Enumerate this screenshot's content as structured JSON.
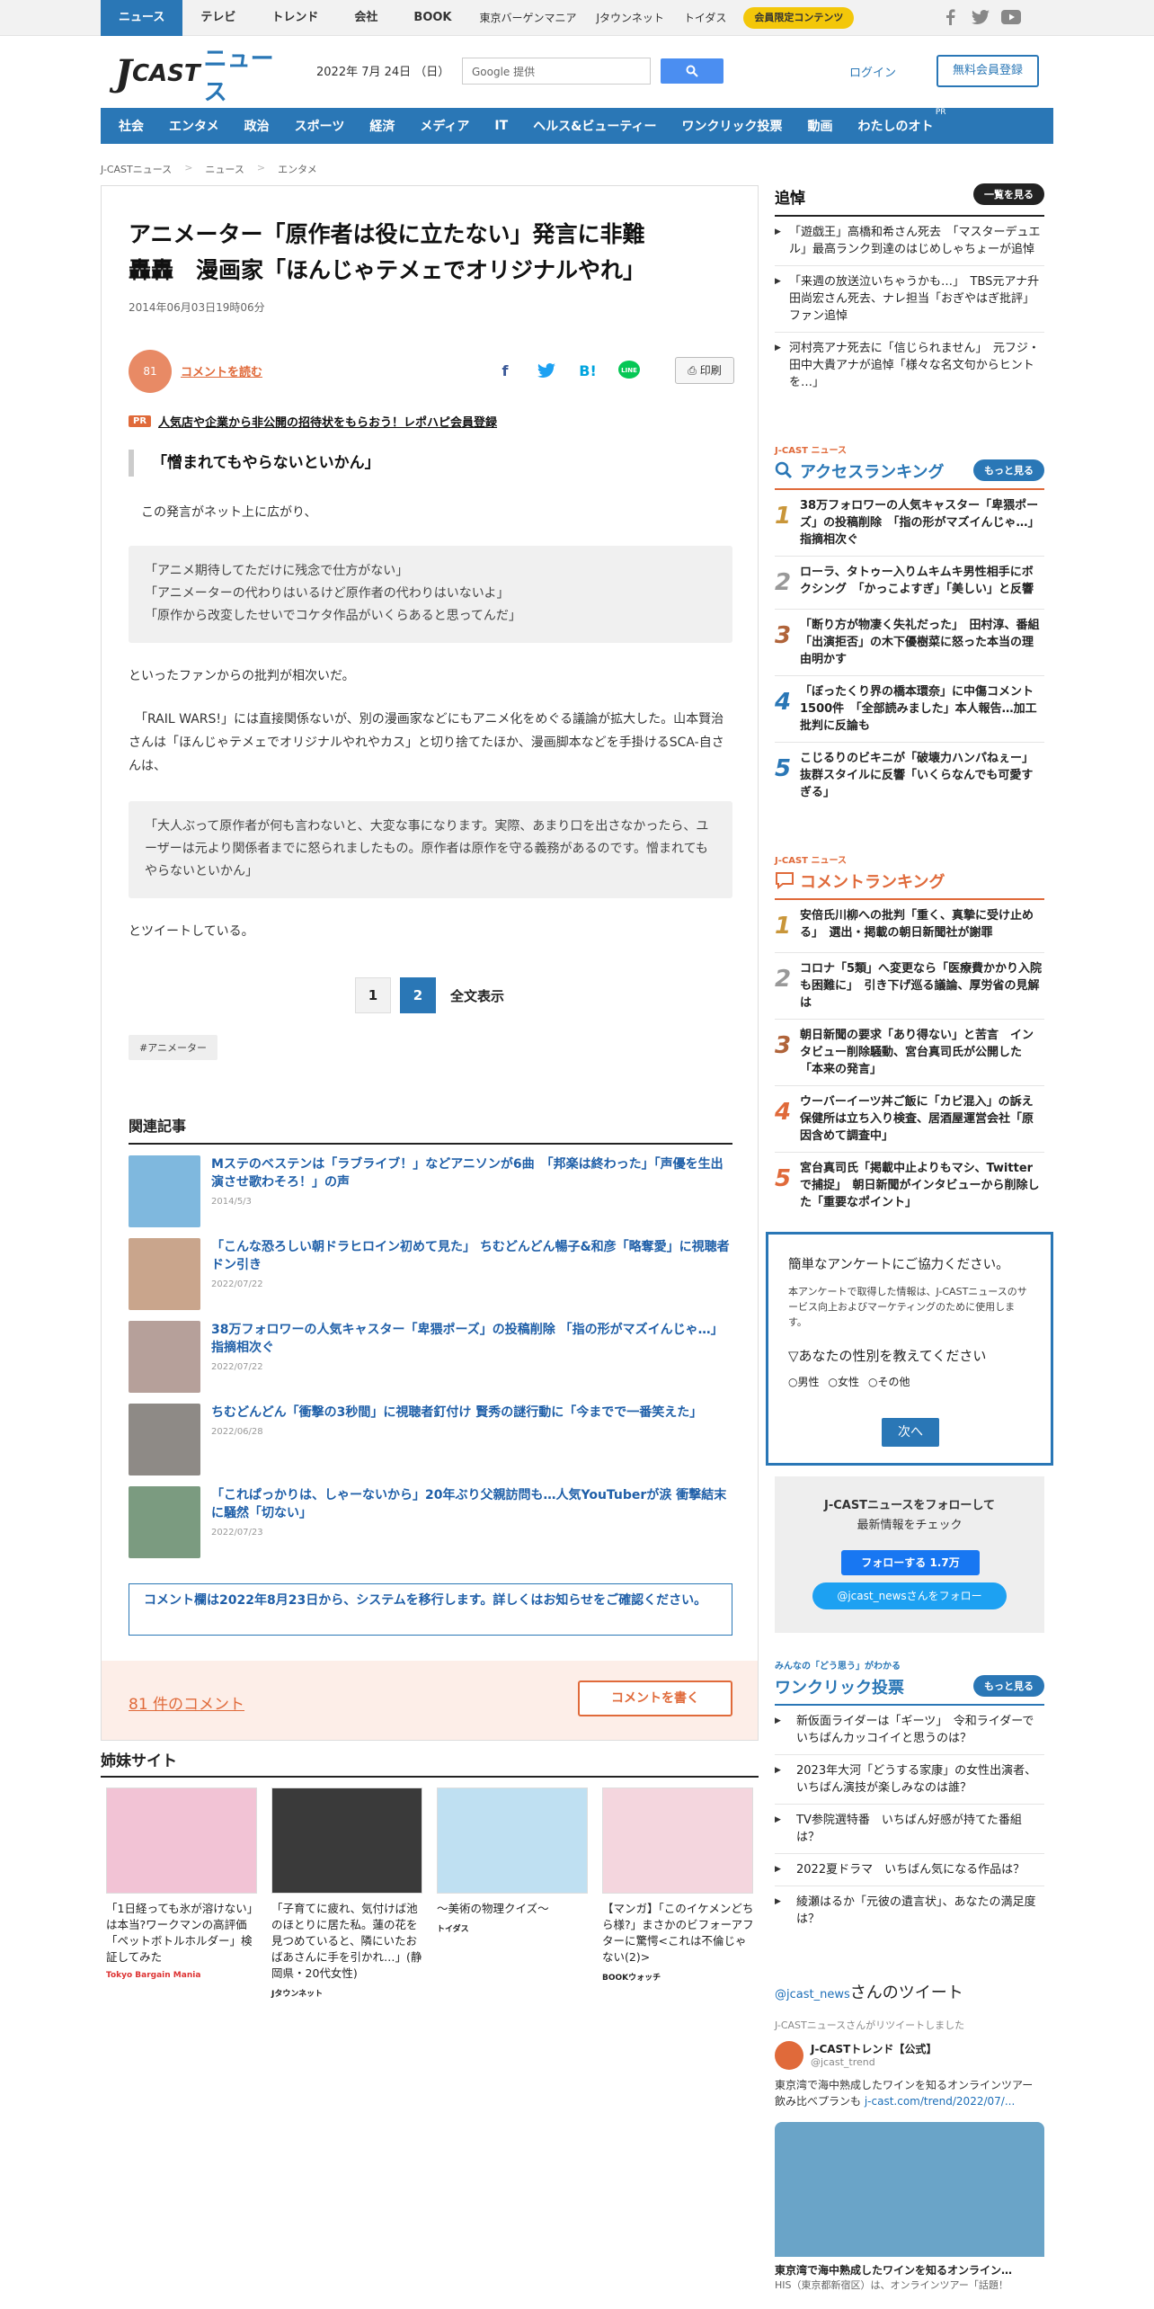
{
  "topnav": {
    "items": [
      "ニュース",
      "テレビ",
      "トレンド",
      "会社",
      "BOOK"
    ],
    "small_items": [
      "東京バーゲンマニア",
      "Jタウンネット",
      "トイダス"
    ],
    "member_label": "会員限定コンテンツ",
    "icons": [
      "facebook-icon",
      "twitter-icon",
      "youtube-icon"
    ]
  },
  "header": {
    "logo_j": "J",
    "logo_cast": "CAST",
    "logo_news": "ニュース",
    "date": "2022年 7月 24日 （日）",
    "search_placeholder": "Google 提供",
    "login": "ログイン",
    "register": "無料会員登録"
  },
  "mainnav": {
    "items": [
      "社会",
      "エンタメ",
      "政治",
      "スポーツ",
      "経済",
      "メディア",
      "IT",
      "ヘルス&ビューティー",
      "ワンクリック投票",
      "動画",
      "わたしのオト"
    ],
    "pr_label": "PR"
  },
  "breadcrumb": [
    "J-CASTニュース",
    "ニュース",
    "エンタメ"
  ],
  "article": {
    "title_1": "アニメーター「原作者は役に立たない」発言に非難",
    "title_2": "轟轟　漫画家「ほんじゃテメェでオリジナルやれ」",
    "date": "2014年06月03日19時06分",
    "comment_count_badge": "81",
    "comment_link": "コメントを読む",
    "print": "印刷",
    "pr_tag": "PR",
    "pr_text": "人気店や企業から非公開の招待状をもらおう！レポハピ会員登録",
    "quote_heading": "「憎まれてもやらないといかん」",
    "p1": "　この発言がネット上に広がり、",
    "q1": [
      "「アニメ期待してただけに残念で仕方がない」",
      "「アニメーターの代わりはいるけど原作者の代わりはいないよ」",
      "「原作から改変したせいでコケタ作品がいくらあると思ってんだ」"
    ],
    "p2": "といったファンからの批判が相次いだ。",
    "p3": "　「RAIL WARS!」には直接関係ないが、別の漫画家などにもアニメ化をめぐる議論が拡大した。山本賢治さんは「ほんじゃテメェでオリジナルやれやカス」と切り捨てたほか、漫画脚本などを手掛けるSCA-自さんは、",
    "q2": "「大人ぶって原作者が何も言わないと、大変な事になります。実際、あまり口を出さなかったら、ユーザーは元より関係者までに怒られましたもの。原作者は原作を守る義務があるのです。憎まれてもやらないといかん」",
    "p4": "とツイートしている。",
    "pages": [
      "1",
      "2"
    ],
    "page_all": "全文表示",
    "tag": "#アニメーター",
    "related_heading": "関連記事",
    "related": [
      {
        "title": "Mステのベステンは「ラブライブ！」などアニソンが6曲　「邦楽は終わった」「声優を生出演させ歌わそろ！」の声",
        "date": "2014/5/3",
        "color": "#7fb8de"
      },
      {
        "title": "「こんな恐ろしい朝ドラヒロイン初めて見た」 ちむどんどん暢子&和彦「略奪愛」に視聴者ドン引き",
        "date": "2022/07/22",
        "color": "#c9a58c"
      },
      {
        "title": "38万フォロワーの人気キャスター「卑猥ポーズ」の投稿削除 「指の形がマズイんじゃ…」指摘相次ぐ",
        "date": "2022/07/22",
        "color": "#b6a09a"
      },
      {
        "title": "ちむどんどん「衝撃の3秒間」に視聴者釘付け 賢秀の謎行動に「今までで一番笑えた」",
        "date": "2022/06/28",
        "color": "#8e8a86"
      },
      {
        "title": "「これぱっかりは、しゃーないから」20年ぶり父親訪問も…人気YouTuberが涙 衝撃結末に騒然「切ない」",
        "date": "2022/07/23",
        "color": "#7b9b80"
      }
    ],
    "notice": "コメント欄は2022年8月23日から、システムを移行します。詳しくはお知らせをご確認ください。",
    "comments_count": "81 件のコメント",
    "write_comment": "コメントを書く"
  },
  "sister": {
    "heading": "姉妹サイト",
    "items": [
      {
        "text": "「1日経っても氷が溶けない」は本当?ワークマンの高評価「ペットボトルホルダー」検証してみた",
        "logo": "Tokyo Bargain Mania",
        "color": "#f2c3d5"
      },
      {
        "text": "「子育てに疲れ、気付けば池のほとりに居た私。蓮の花を見つめていると、隣にいたおばあさんに手を引かれ…」(静岡県・20代女性)",
        "logo": "Jタウンネット",
        "color": "#3a3a3a"
      },
      {
        "text": "〜美術の物理クイズ〜",
        "logo": "トイダス",
        "color": "#bfe0f2"
      },
      {
        "text": "【マンガ】「このイケメンどちら様?」まさかのビフォーアフターに驚愕<これは不倫じゃない(2)>",
        "logo": "BOOKウォッチ",
        "color": "#f4d6de"
      }
    ]
  },
  "sidebar": {
    "obit_heading": "追悼",
    "obit_more": "一覧を見る",
    "obits": [
      "「遊戯王」高橋和希さん死去　「マスターデュエル」最高ランク到達のはじめしゃちょーが追悼",
      "「来週の放送泣いちゃうかも…」　TBS元アナ升田尚宏さん死去、ナレ担当「おぎやはぎ批評」ファン追悼",
      "河村亮アナ死去に「信じられません」　元フジ・田中大貴アナが追悼「様々な名文句からヒントを…」"
    ],
    "access_sub": "J-CAST ニュース",
    "access_heading": "アクセスランキング",
    "access_more": "もっと見る",
    "access": [
      "38万フォロワーの人気キャスター「卑猥ポーズ」の投稿削除　「指の形がマズイんじゃ…」指摘相次ぐ",
      "ローラ、タトゥー入りムキムキ男性相手にボクシング　「かっこよすぎ」「美しい」と反響",
      "「断り方が物凄く失礼だった」　田村淳、番組「出演拒否」の木下優樹菜に怒った本当の理由明かす",
      "「ぼったくり界の橋本環奈」に中傷コメント1500件　「全部読みました」本人報告…加工批判に反論も",
      "こじるりのビキニが「破壊力ハンパねぇー」　抜群スタイルに反響「いくらなんでも可愛すぎる」"
    ],
    "comment_sub": "J-CAST ニュース",
    "comment_heading": "コメントランキング",
    "comment_rank": [
      "安倍氏川柳への批判「重く、真摯に受け止める」　選出・掲載の朝日新聞社が謝罪",
      "コロナ「5類」へ変更なら「医療費かかり入院も困難に」　引き下げ巡る議論、厚労省の見解は",
      "朝日新聞の要求「あり得ない」と苦言　インタビュー削除騒動、宮台真司氏が公開した「本来の発言」",
      "ウーバーイーツ丼ご飯に「カビ混入」の訴え　保健所は立ち入り検査、居酒屋運営会社「原因含めて調査中」",
      "宮台真司氏「掲載中止よりもマシ、Twitterで捕捉」　朝日新聞がインタビューから削除した「重要なポイント」"
    ],
    "survey_title": "簡単なアンケートにご協力ください。",
    "survey_desc": "本アンケートで取得した情報は、J-CASTニュースのサービス向上およびマーケティングのために使用します。",
    "survey_q": "▽あなたの性別を教えてください",
    "survey_opts": [
      "男性",
      "女性",
      "その他"
    ],
    "survey_next": "次へ",
    "follow_line1": "J-CASTニュースをフォローして",
    "follow_line2": "最新情報をチェック",
    "follow_fb": "フォローする 1.7万",
    "follow_tw": "@jcast_newsさんをフォロー",
    "vote_sub": "みんなの「どう思う」がわかる",
    "vote_heading": "ワンクリック投票",
    "vote_more": "もっと見る",
    "votes": [
      "新仮面ライダーは「ギーツ」　令和ライダーでいちばんカッコイイと思うのは？",
      "2023年大河「どうする家康」の女性出演者、いちばん演技が楽しみなのは誰？",
      "TV参院選特番　いちばん好感が持てた番組は？",
      "2022夏ドラマ　いちばん気になる作品は？",
      "綾瀬はるか「元彼の遺言状」、あなたの満足度は？"
    ],
    "tweet_heading_1": "@jcast_news",
    "tweet_heading_2": "さんのツイート",
    "retweet_note": "J-CASTニュースさんがリツイートしました",
    "tweet_name": "J-CASTトレンド【公式】",
    "tweet_handle": "@jcast_trend",
    "tweet_text": "東京湾で海中熟成したワインを知るオンラインツアー 飲み比べプランも",
    "tweet_link": "j-cast.com/trend/2022/07/...",
    "card_title": "東京湾で海中熟成したワインを知るオンライン…",
    "card_desc": "HIS（東京都新宿区）は、オンラインツアー「話題！"
  }
}
